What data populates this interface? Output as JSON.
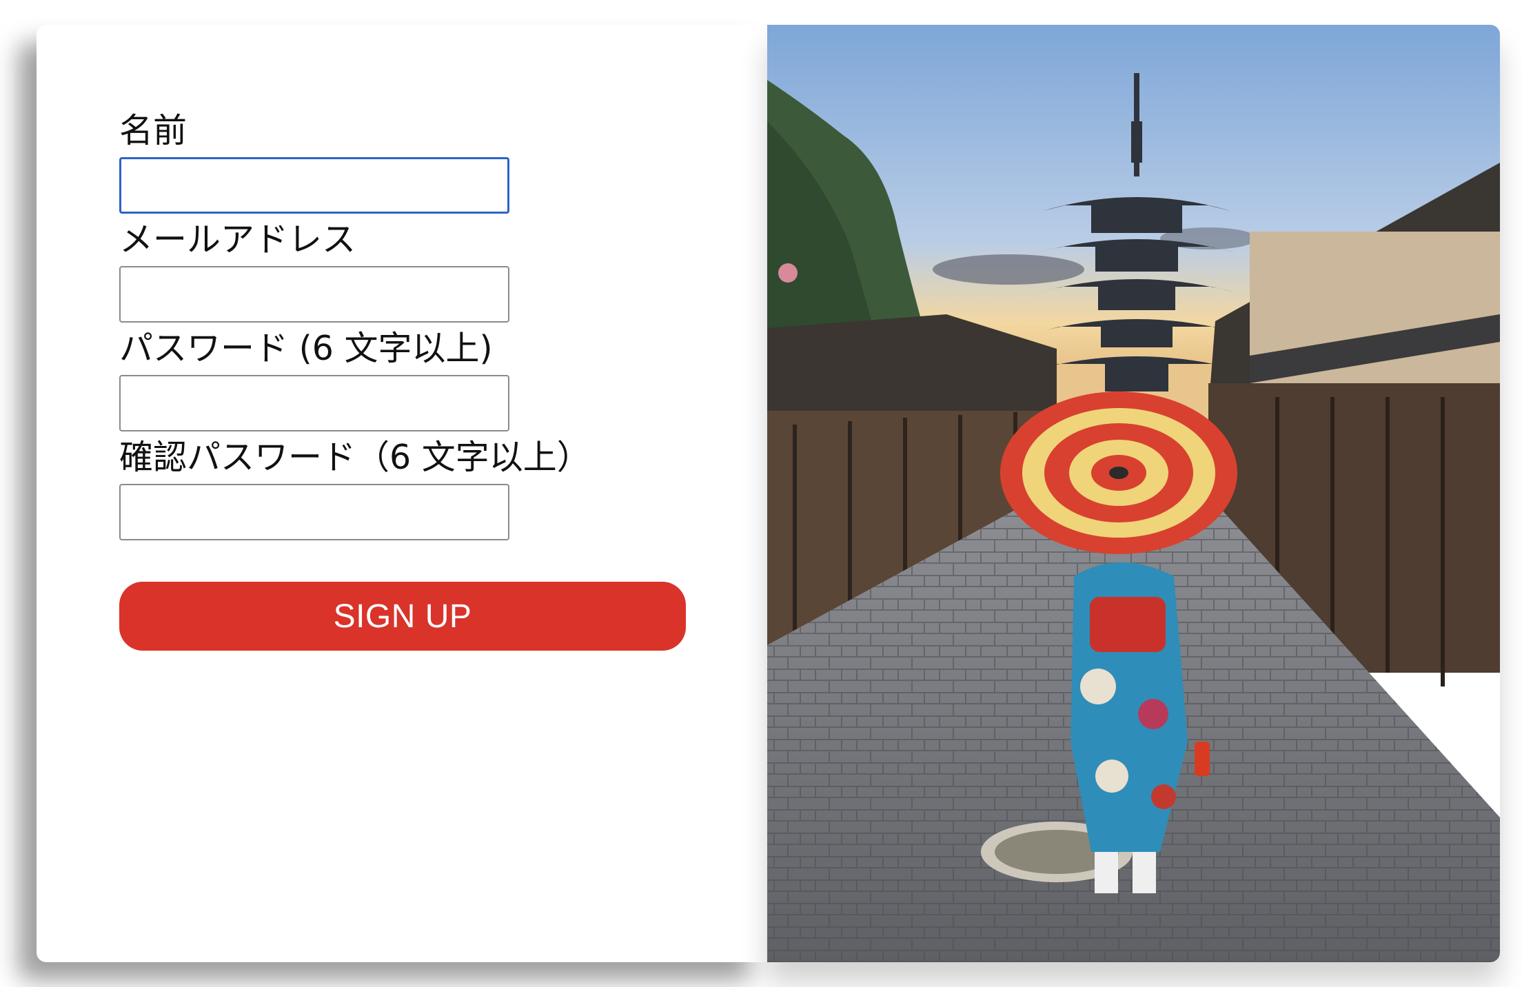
{
  "form": {
    "fields": [
      {
        "label": "名前",
        "value": "",
        "placeholder": ""
      },
      {
        "label": "メールアドレス",
        "value": "",
        "placeholder": ""
      },
      {
        "label": "パスワード (6 文字以上)",
        "value": "",
        "placeholder": ""
      },
      {
        "label": "確認パスワード（6 文字以上）",
        "value": "",
        "placeholder": ""
      }
    ],
    "focus_color": "#2a63c9",
    "submit_label": "SIGN UP",
    "submit_color": "#d9332a"
  },
  "hero_image": {
    "subject": "kimono-woman-with-red-umbrella-on-kyoto-street-with-pagoda"
  }
}
